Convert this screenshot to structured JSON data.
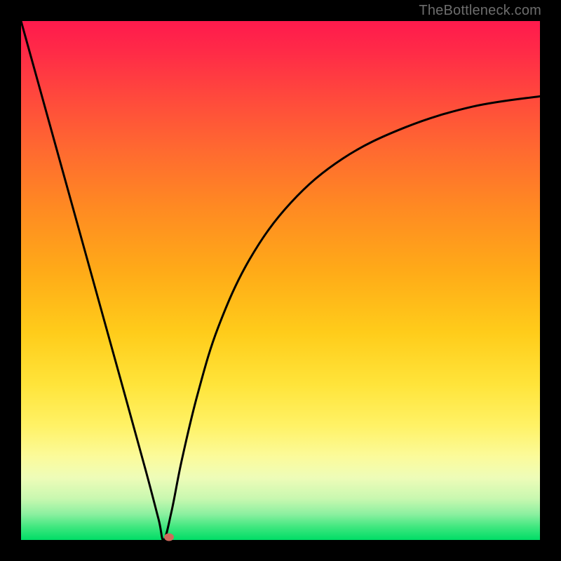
{
  "watermark": "TheBottleneck.com",
  "chart_data": {
    "type": "line",
    "title": "",
    "xlabel": "",
    "ylabel": "",
    "x_range": [
      0,
      1
    ],
    "y_range": [
      0,
      1
    ],
    "background_gradient": {
      "top_color": "#ff1a4d",
      "mid_colors": [
        "#ff8a22",
        "#ffe43a"
      ],
      "bottom_color": "#00dd66",
      "meaning": "red=high bottleneck, green=optimal"
    },
    "minimum_point": {
      "x": 0.275,
      "y": 0.0
    },
    "marker": {
      "x": 0.285,
      "y": 0.005,
      "color": "#cf6a5c"
    },
    "left_branch": {
      "description": "steep near-linear descent from top-left to minimum",
      "x": [
        0.0,
        0.05,
        0.1,
        0.15,
        0.2,
        0.24,
        0.265,
        0.275
      ],
      "y": [
        1.0,
        0.82,
        0.64,
        0.46,
        0.28,
        0.135,
        0.04,
        0.0
      ]
    },
    "right_branch": {
      "description": "concave asymptotic rise from minimum toward upper right",
      "x": [
        0.275,
        0.29,
        0.31,
        0.34,
        0.38,
        0.44,
        0.52,
        0.62,
        0.74,
        0.87,
        1.0
      ],
      "y": [
        0.0,
        0.055,
        0.155,
        0.28,
        0.41,
        0.54,
        0.65,
        0.735,
        0.795,
        0.835,
        0.855
      ]
    }
  }
}
